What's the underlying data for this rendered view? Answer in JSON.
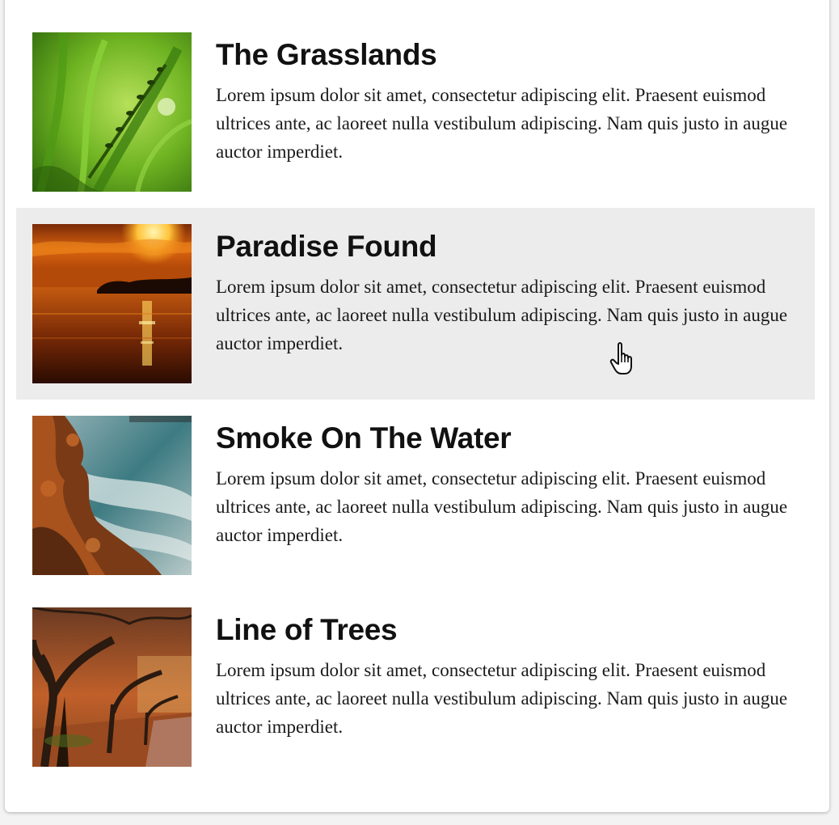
{
  "items": [
    {
      "title": "The Grasslands",
      "description": "Lorem ipsum dolor sit amet, consectetur adipiscing elit. Praesent euismod ultrices ante, ac laoreet nulla vestibulum adipiscing. Nam quis justo in augue auctor imperdiet.",
      "image": "grass-photo",
      "hovered": false
    },
    {
      "title": "Paradise Found",
      "description": "Lorem ipsum dolor sit amet, consectetur adipiscing elit. Praesent euismod ultrices ante, ac laoreet nulla vestibulum adipiscing. Nam quis justo in augue auctor imperdiet.",
      "image": "sunset-photo",
      "hovered": true
    },
    {
      "title": "Smoke On The Water",
      "description": "Lorem ipsum dolor sit amet, consectetur adipiscing elit. Praesent euismod ultrices ante, ac laoreet nulla vestibulum adipiscing. Nam quis justo in augue auctor imperdiet.",
      "image": "coast-photo",
      "hovered": false
    },
    {
      "title": "Line of Trees",
      "description": "Lorem ipsum dolor sit amet, consectetur adipiscing elit. Praesent euismod ultrices ante, ac laoreet nulla vestibulum adipiscing. Nam quis justo in augue auctor imperdiet.",
      "image": "trees-photo",
      "hovered": false
    }
  ],
  "colors": {
    "card_background": "#ffffff",
    "hover_background": "#ececec",
    "title_text": "#111111",
    "body_text": "#1a1a1a"
  },
  "cursor": "hand-pointer-icon"
}
